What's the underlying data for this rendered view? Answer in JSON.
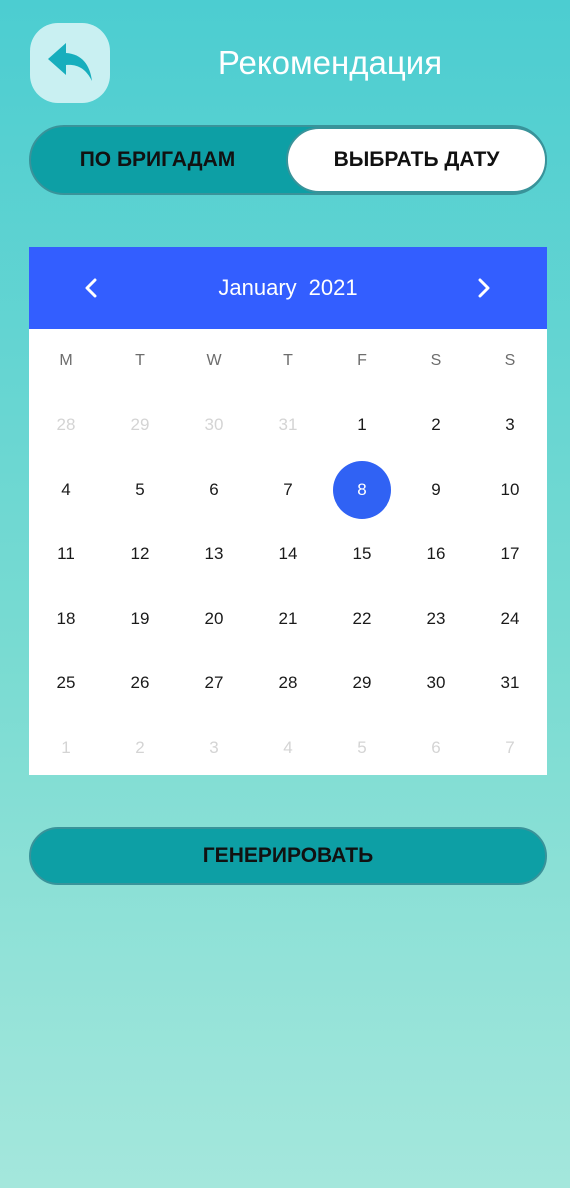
{
  "header": {
    "title": "Рекомендация",
    "back_icon": "reply-arrow-icon",
    "back_icon_color": "#17aebd"
  },
  "mode_toggle": {
    "tab_brigades": "ПО БРИГАДАМ",
    "tab_pick_date": "ВЫБРАТЬ ДАТУ",
    "selected": "ВЫБРАТЬ ДАТУ"
  },
  "calendar": {
    "month": "January",
    "year": "2021",
    "prev_icon": "chevron-left-icon",
    "next_icon": "chevron-right-icon",
    "header_color": "#335eff",
    "selected_color": "#3062f4",
    "weekdays": [
      "M",
      "T",
      "W",
      "T",
      "F",
      "S",
      "S"
    ],
    "selected_day": "8",
    "weeks": [
      [
        {
          "d": "28",
          "m": true
        },
        {
          "d": "29",
          "m": true
        },
        {
          "d": "30",
          "m": true
        },
        {
          "d": "31",
          "m": true
        },
        {
          "d": "1"
        },
        {
          "d": "2"
        },
        {
          "d": "3"
        }
      ],
      [
        {
          "d": "4"
        },
        {
          "d": "5"
        },
        {
          "d": "6"
        },
        {
          "d": "7"
        },
        {
          "d": "8",
          "sel": true
        },
        {
          "d": "9"
        },
        {
          "d": "10"
        }
      ],
      [
        {
          "d": "11"
        },
        {
          "d": "12"
        },
        {
          "d": "13"
        },
        {
          "d": "14"
        },
        {
          "d": "15"
        },
        {
          "d": "16"
        },
        {
          "d": "17"
        }
      ],
      [
        {
          "d": "18"
        },
        {
          "d": "19"
        },
        {
          "d": "20"
        },
        {
          "d": "21"
        },
        {
          "d": "22"
        },
        {
          "d": "23"
        },
        {
          "d": "24"
        }
      ],
      [
        {
          "d": "25"
        },
        {
          "d": "26"
        },
        {
          "d": "27"
        },
        {
          "d": "28"
        },
        {
          "d": "29"
        },
        {
          "d": "30"
        },
        {
          "d": "31"
        }
      ],
      [
        {
          "d": "1",
          "m": true
        },
        {
          "d": "2",
          "m": true
        },
        {
          "d": "3",
          "m": true
        },
        {
          "d": "4",
          "m": true
        },
        {
          "d": "5",
          "m": true
        },
        {
          "d": "6",
          "m": true
        },
        {
          "d": "7",
          "m": true
        }
      ]
    ]
  },
  "actions": {
    "generate_label": "ГЕНЕРИРОВАТЬ"
  }
}
